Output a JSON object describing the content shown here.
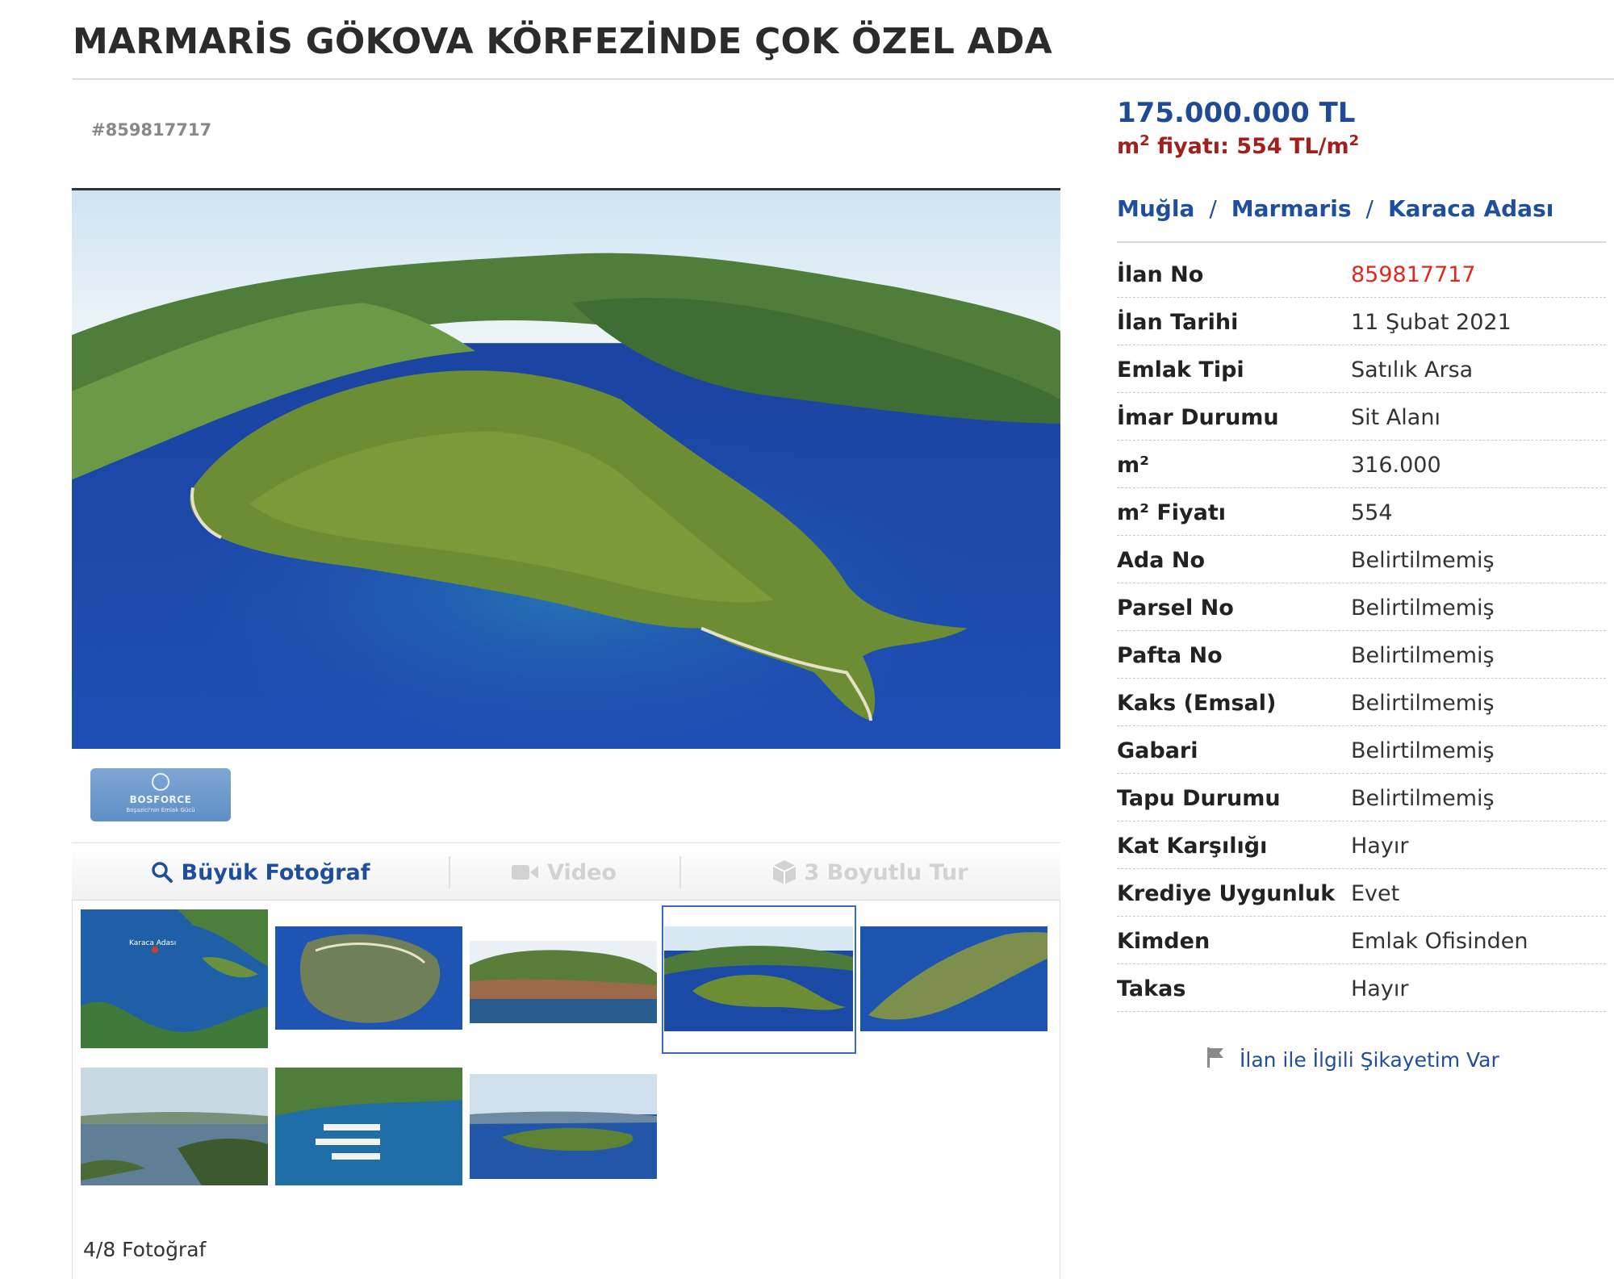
{
  "listing": {
    "title": "MARMARİS GÖKOVA KÖRFEZİNDE ÇOK ÖZEL ADA",
    "id_label": "#859817717"
  },
  "gallery": {
    "agency_logo": {
      "name": "BOSFORCE",
      "tagline": "Boşazici'nin Emlak Gücü"
    },
    "tabs": {
      "photo_label": "Büyük Fotoğraf",
      "video_label": "Video",
      "tour_label": "3 Boyutlu Tur"
    },
    "photo_counter": "4/8 Fotoğraf",
    "selected_index": 4,
    "total": 8,
    "thumb_label": "Karaca Adası"
  },
  "price": {
    "total": "175.000.000 TL",
    "m2_prefix": "m",
    "m2_sup": "2",
    "m2_text": " fiyatı: 554 TL/m",
    "m2_unit_sup": "2"
  },
  "breadcrumb": {
    "city": "Muğla",
    "district": "Marmaris",
    "area": "Karaca Adası",
    "separator": "/"
  },
  "details": [
    {
      "key": "İlan No",
      "value": "859817717"
    },
    {
      "key": "İlan Tarihi",
      "value": "11 Şubat 2021"
    },
    {
      "key": "Emlak Tipi",
      "value": "Satılık Arsa"
    },
    {
      "key": "İmar Durumu",
      "value": "Sit Alanı"
    },
    {
      "key": "m²",
      "value": "316.000"
    },
    {
      "key": "m² Fiyatı",
      "value": "554"
    },
    {
      "key": "Ada No",
      "value": "Belirtilmemiş"
    },
    {
      "key": "Parsel No",
      "value": "Belirtilmemiş"
    },
    {
      "key": "Pafta No",
      "value": "Belirtilmemiş"
    },
    {
      "key": "Kaks (Emsal)",
      "value": "Belirtilmemiş"
    },
    {
      "key": "Gabari",
      "value": "Belirtilmemiş"
    },
    {
      "key": "Tapu Durumu",
      "value": "Belirtilmemiş"
    },
    {
      "key": "Kat Karşılığı",
      "value": "Hayır"
    },
    {
      "key": "Krediye Uygunluk",
      "value": "Evet"
    },
    {
      "key": "Kimden",
      "value": "Emlak Ofisinden"
    },
    {
      "key": "Takas",
      "value": "Hayır"
    }
  ],
  "complaint": {
    "label": "İlan ile İlgili Şikayetim Var"
  },
  "colors": {
    "link_blue": "#1f4e9e",
    "price_blue": "#1e4a97",
    "price_red": "#a2201c",
    "id_red": "#e0281e"
  }
}
